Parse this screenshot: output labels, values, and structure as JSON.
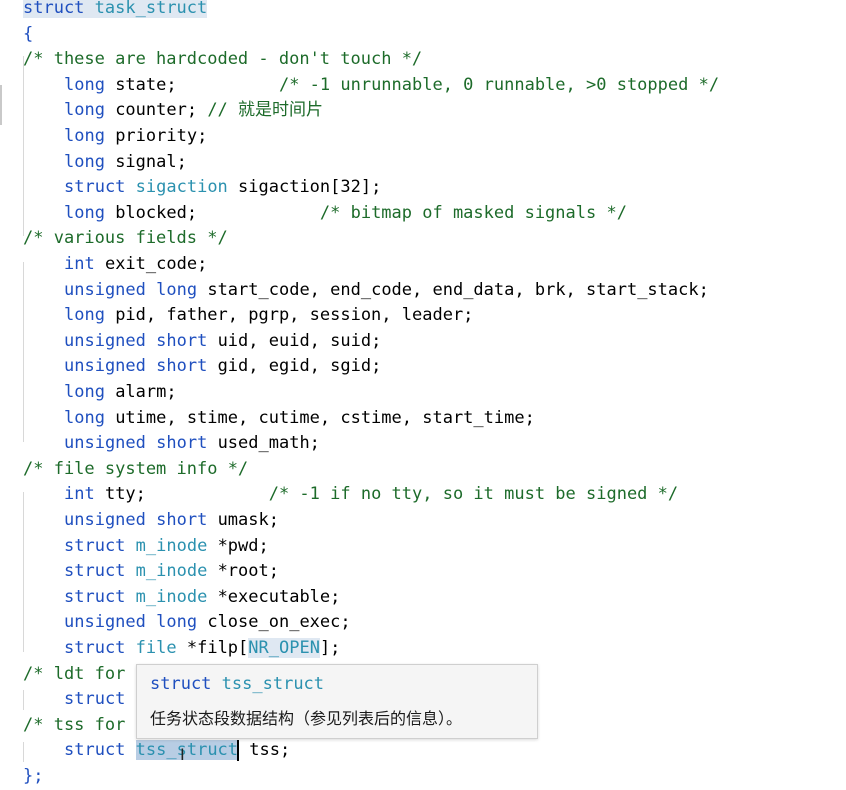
{
  "editor": {
    "lines": [
      {
        "indent": 0,
        "tokens": [
          {
            "t": "struct",
            "c": "kw hl-sel"
          },
          {
            "t": " ",
            "c": "hl-sel"
          },
          {
            "t": "task_struct",
            "c": "ty hl-sel"
          }
        ]
      },
      {
        "indent": 0,
        "tokens": [
          {
            "t": "{",
            "c": "kw"
          }
        ]
      },
      {
        "indent": 0,
        "tokens": [
          {
            "t": "/* these are hardcoded - don't touch */",
            "c": "cm"
          }
        ]
      },
      {
        "indent": 1,
        "tokens": [
          {
            "t": "long",
            "c": "kw"
          },
          {
            "t": " state;          ",
            "c": ""
          },
          {
            "t": "/* -1 unrunnable, 0 runnable, >0 stopped */",
            "c": "cm"
          }
        ]
      },
      {
        "indent": 1,
        "tokens": [
          {
            "t": "long",
            "c": "kw"
          },
          {
            "t": " counter; ",
            "c": ""
          },
          {
            "t": "// 就是时间片",
            "c": "cm"
          }
        ]
      },
      {
        "indent": 1,
        "tokens": [
          {
            "t": "long",
            "c": "kw"
          },
          {
            "t": " priority;",
            "c": ""
          }
        ]
      },
      {
        "indent": 1,
        "tokens": [
          {
            "t": "long",
            "c": "kw"
          },
          {
            "t": " signal;",
            "c": ""
          }
        ]
      },
      {
        "indent": 1,
        "tokens": [
          {
            "t": "struct",
            "c": "kw"
          },
          {
            "t": " ",
            "c": ""
          },
          {
            "t": "sigaction",
            "c": "ty"
          },
          {
            "t": " sigaction[32];",
            "c": ""
          }
        ]
      },
      {
        "indent": 1,
        "tokens": [
          {
            "t": "long",
            "c": "kw"
          },
          {
            "t": " blocked;            ",
            "c": ""
          },
          {
            "t": "/* bitmap of masked signals */",
            "c": "cm"
          }
        ]
      },
      {
        "indent": 0,
        "tokens": [
          {
            "t": "/* various fields */",
            "c": "cm"
          }
        ]
      },
      {
        "indent": 1,
        "tokens": [
          {
            "t": "int",
            "c": "kw"
          },
          {
            "t": " exit_code;",
            "c": ""
          }
        ]
      },
      {
        "indent": 1,
        "tokens": [
          {
            "t": "unsigned",
            "c": "kw"
          },
          {
            "t": " ",
            "c": ""
          },
          {
            "t": "long",
            "c": "kw"
          },
          {
            "t": " start_code, end_code, end_data, brk, start_stack;",
            "c": ""
          }
        ]
      },
      {
        "indent": 1,
        "tokens": [
          {
            "t": "long",
            "c": "kw"
          },
          {
            "t": " pid, father, pgrp, session, leader;",
            "c": ""
          }
        ]
      },
      {
        "indent": 1,
        "tokens": [
          {
            "t": "unsigned",
            "c": "kw"
          },
          {
            "t": " ",
            "c": ""
          },
          {
            "t": "short",
            "c": "kw"
          },
          {
            "t": " uid, euid, suid;",
            "c": ""
          }
        ]
      },
      {
        "indent": 1,
        "tokens": [
          {
            "t": "unsigned",
            "c": "kw"
          },
          {
            "t": " ",
            "c": ""
          },
          {
            "t": "short",
            "c": "kw"
          },
          {
            "t": " gid, egid, sgid;",
            "c": ""
          }
        ]
      },
      {
        "indent": 1,
        "tokens": [
          {
            "t": "long",
            "c": "kw"
          },
          {
            "t": " alarm;",
            "c": ""
          }
        ]
      },
      {
        "indent": 1,
        "tokens": [
          {
            "t": "long",
            "c": "kw"
          },
          {
            "t": " utime, stime, cutime, cstime, start_time;",
            "c": ""
          }
        ]
      },
      {
        "indent": 1,
        "tokens": [
          {
            "t": "unsigned",
            "c": "kw"
          },
          {
            "t": " ",
            "c": ""
          },
          {
            "t": "short",
            "c": "kw"
          },
          {
            "t": " used_math;",
            "c": ""
          }
        ]
      },
      {
        "indent": 0,
        "tokens": [
          {
            "t": "/* file system info */",
            "c": "cm"
          }
        ]
      },
      {
        "indent": 1,
        "tokens": [
          {
            "t": "int",
            "c": "kw"
          },
          {
            "t": " tty;            ",
            "c": ""
          },
          {
            "t": "/* -1 if no tty, so it must be signed */",
            "c": "cm"
          }
        ]
      },
      {
        "indent": 1,
        "tokens": [
          {
            "t": "unsigned",
            "c": "kw"
          },
          {
            "t": " ",
            "c": ""
          },
          {
            "t": "short",
            "c": "kw"
          },
          {
            "t": " umask;",
            "c": ""
          }
        ]
      },
      {
        "indent": 1,
        "tokens": [
          {
            "t": "struct",
            "c": "kw"
          },
          {
            "t": " ",
            "c": ""
          },
          {
            "t": "m_inode",
            "c": "ty"
          },
          {
            "t": " *pwd;",
            "c": ""
          }
        ]
      },
      {
        "indent": 1,
        "tokens": [
          {
            "t": "struct",
            "c": "kw"
          },
          {
            "t": " ",
            "c": ""
          },
          {
            "t": "m_inode",
            "c": "ty"
          },
          {
            "t": " *root;",
            "c": ""
          }
        ]
      },
      {
        "indent": 1,
        "tokens": [
          {
            "t": "struct",
            "c": "kw"
          },
          {
            "t": " ",
            "c": ""
          },
          {
            "t": "m_inode",
            "c": "ty"
          },
          {
            "t": " *executable;",
            "c": ""
          }
        ]
      },
      {
        "indent": 1,
        "tokens": [
          {
            "t": "unsigned",
            "c": "kw"
          },
          {
            "t": " ",
            "c": ""
          },
          {
            "t": "long",
            "c": "kw"
          },
          {
            "t": " close_on_exec;",
            "c": ""
          }
        ]
      },
      {
        "indent": 1,
        "tokens": [
          {
            "t": "struct",
            "c": "kw"
          },
          {
            "t": " ",
            "c": ""
          },
          {
            "t": "file",
            "c": "ty"
          },
          {
            "t": " *filp[",
            "c": ""
          },
          {
            "t": "NR_OPEN",
            "c": "ty hl-sel"
          },
          {
            "t": "];",
            "c": ""
          }
        ]
      },
      {
        "indent": 0,
        "tokens": [
          {
            "t": "/* ldt for",
            "c": "cm"
          }
        ]
      },
      {
        "indent": 1,
        "tokens": [
          {
            "t": "struct",
            "c": "kw"
          }
        ]
      },
      {
        "indent": 0,
        "tokens": [
          {
            "t": "/* tss for",
            "c": "cm"
          }
        ]
      },
      {
        "indent": 1,
        "tokens": [
          {
            "t": "struct",
            "c": "kw"
          },
          {
            "t": " ",
            "c": ""
          },
          {
            "t": "tss_struct",
            "c": "ty hl-word"
          },
          {
            "t": "|",
            "c": "cursor-mark"
          },
          {
            "t": " tss;",
            "c": ""
          }
        ]
      },
      {
        "indent": 0,
        "tokens": [
          {
            "t": "};",
            "c": "kw"
          }
        ]
      }
    ]
  },
  "tooltip": {
    "signature_kw": "struct",
    "signature_name": "tss_struct",
    "description": "任务状态段数据结构（参见列表后的信息）。"
  },
  "colors": {
    "keyword": "#1f4fbf",
    "type": "#2b91af",
    "comment": "#1d6b2a",
    "word_highlight": "#b8cde4"
  }
}
